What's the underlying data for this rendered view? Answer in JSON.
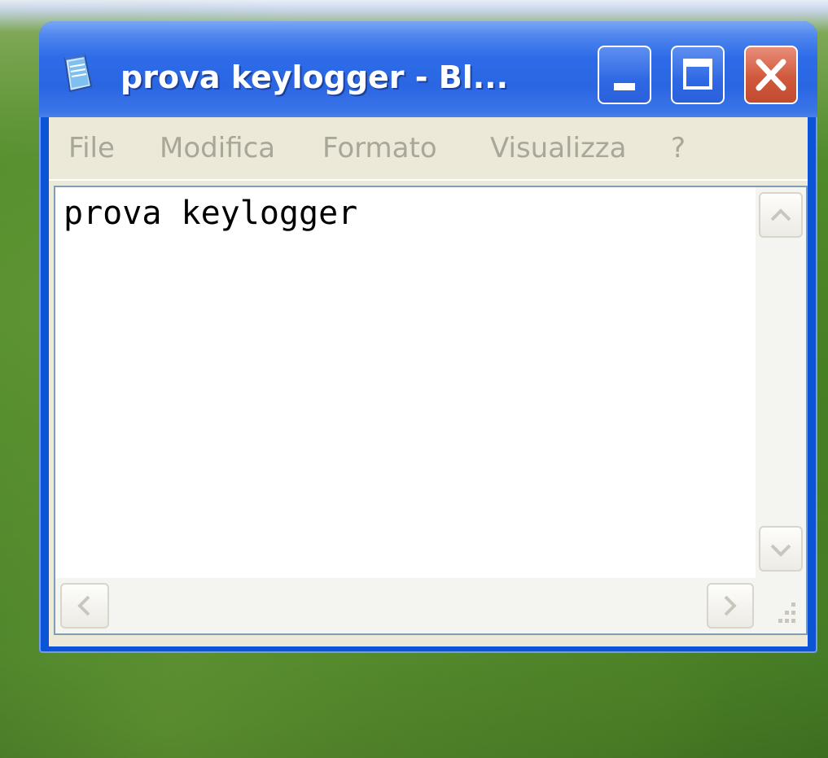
{
  "window": {
    "title": "prova keylogger - Bl...",
    "icon": "notepad-icon",
    "controls": {
      "minimize": "minimize-icon",
      "maximize": "maximize-icon",
      "close": "close-icon"
    },
    "colors": {
      "titlebar": "#2a66e2",
      "close_button": "#d0593d",
      "menu_background": "#ece9d8"
    }
  },
  "menu": {
    "items": [
      {
        "label": "File"
      },
      {
        "label": "Modifica"
      },
      {
        "label": "Formato"
      },
      {
        "label": "Visualizza"
      },
      {
        "label": "?"
      }
    ]
  },
  "editor": {
    "content": "prova keylogger"
  },
  "scrollbars": {
    "up": "chevron-up-icon",
    "down": "chevron-down-icon",
    "left": "chevron-left-icon",
    "right": "chevron-right-icon",
    "grip": "resize-grip-icon"
  }
}
